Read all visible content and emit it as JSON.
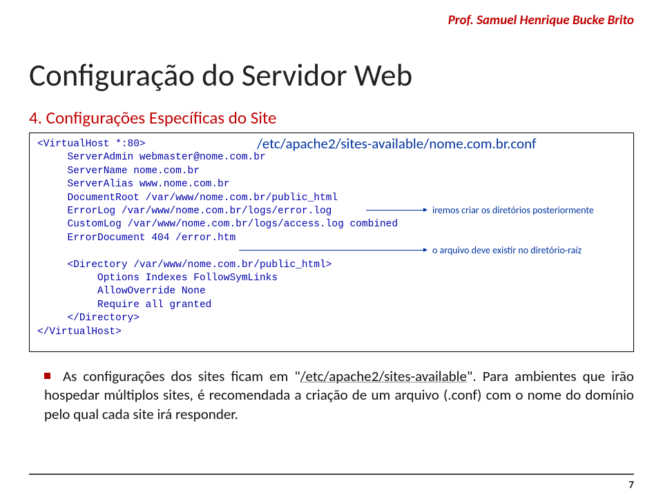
{
  "header": {
    "author": "Prof. Samuel Henrique Bucke Brito"
  },
  "title": "Configuração do Servidor Web",
  "subtitle": "4. Configurações Específicas do Site",
  "codepath": "/etc/apache2/sites-available/nome.com.br.conf",
  "code": {
    "l1": "<VirtualHost *:80>",
    "l2": "     ServerAdmin webmaster@nome.com.br",
    "l3": "     ServerName nome.com.br",
    "l4": "     ServerAlias www.nome.com.br",
    "l5": "     DocumentRoot /var/www/nome.com.br/public_html",
    "l6": "     ErrorLog /var/www/nome.com.br/logs/error.log",
    "l7": "     CustomLog /var/www/nome.com.br/logs/access.log combined",
    "l8": "     ErrorDocument 404 /error.htm",
    "l9": "",
    "l10": "     <Directory /var/www/nome.com.br/public_html>",
    "l11": "          Options Indexes FollowSymLinks",
    "l12": "          AllowOverride None",
    "l13": "          Require all granted",
    "l14": "     </Directory>",
    "l15": "</VirtualHost>"
  },
  "notes": {
    "n1": "iremos criar os diretórios posteriormente",
    "n2": "o arquivo deve existir no diretório-raíz"
  },
  "bullet": {
    "pre": "As configurações dos sites ficam em ",
    "quoted": "/etc/apache2/sites-available",
    "post": ". Para ambientes que irão hospedar múltiplos sites, é recomendada a criação de um arquivo (.conf) com o nome do domínio pelo qual cada site irá responder."
  },
  "page": "7"
}
